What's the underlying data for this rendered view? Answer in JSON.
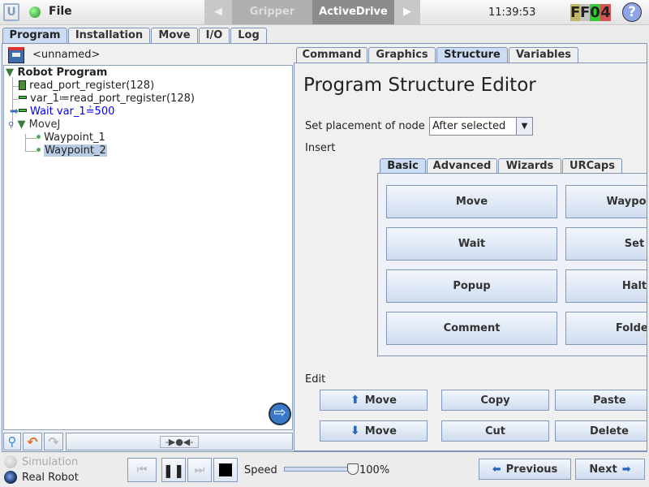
{
  "topbar": {
    "file_label": "File",
    "tabs": [
      {
        "label": "Gripper"
      },
      {
        "label": "ActiveDrive"
      }
    ],
    "time": "11:39:53",
    "status_code": [
      "F",
      "F",
      "0",
      "4"
    ],
    "help_icon": "question-icon"
  },
  "main_tabs": [
    {
      "label": "Program"
    },
    {
      "label": "Installation"
    },
    {
      "label": "Move"
    },
    {
      "label": "I/O"
    },
    {
      "label": "Log"
    }
  ],
  "program": {
    "name": "<unnamed>",
    "tree": [
      {
        "label": "Robot Program",
        "icon": "triangle-down-icon"
      },
      {
        "label": "read_port_register(128)",
        "icon": "script-icon"
      },
      {
        "label": "var_1≔read_port_register(128)",
        "icon": "assignment-icon"
      },
      {
        "label": "Wait var_1≟500",
        "icon": "wait-icon"
      },
      {
        "label": "MoveJ",
        "icon": "triangle-down-icon"
      },
      {
        "label": "Waypoint_1",
        "icon": "waypoint-icon"
      },
      {
        "label": "Waypoint_2",
        "icon": "waypoint-icon"
      }
    ]
  },
  "right_tabs": [
    {
      "label": "Command"
    },
    {
      "label": "Graphics"
    },
    {
      "label": "Structure"
    },
    {
      "label": "Variables"
    }
  ],
  "editor": {
    "title": "Program Structure Editor",
    "placement_label": "Set placement of node",
    "placement_value": "After selected",
    "insert_label": "Insert",
    "insert_tabs": [
      {
        "label": "Basic"
      },
      {
        "label": "Advanced"
      },
      {
        "label": "Wizards"
      },
      {
        "label": "URCaps"
      }
    ],
    "insert_buttons": [
      "Move",
      "Waypoint",
      "Wait",
      "Set",
      "Popup",
      "Halt",
      "Comment",
      "Folder"
    ],
    "edit_label": "Edit",
    "edit_buttons": {
      "move_up": "Move",
      "copy": "Copy",
      "paste": "Paste",
      "move_down": "Move",
      "cut": "Cut",
      "delete": "Delete"
    }
  },
  "footer": {
    "simulation": "Simulation",
    "real_robot": "Real Robot",
    "speed_label": "Speed",
    "speed_value": "100%",
    "speed_percent": 100,
    "previous": "Previous",
    "next": "Next"
  },
  "colors": {
    "accent": "#cbdcf3",
    "selected": "#b8cce6",
    "link": "#0000ee"
  }
}
